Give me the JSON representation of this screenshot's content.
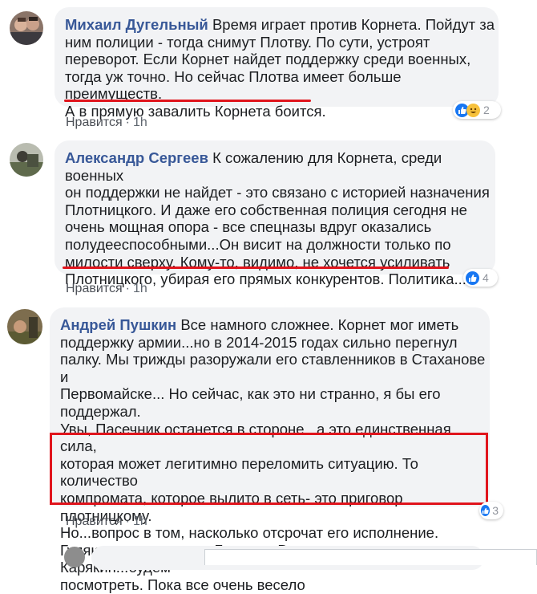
{
  "colors": {
    "highlight": "#e0141c",
    "like": "#1877f2",
    "haha": "#f7c13b"
  },
  "comments": [
    {
      "author": "Михаил Дугельный",
      "lines": [
        "Время играет против Корнета. Пойдут за",
        "ним полиции - тогда снимут Плотву. По сути, устроят",
        "переворот. Если Корнет найдет поддержку среди военных,",
        "тогда уж точно. Но сейчас Плотва имеет больше преимуществ.",
        "А в прямую завалить Корнета боится."
      ],
      "like_label": "Нравится",
      "time": "1h",
      "reaction_count": "2",
      "reactions": [
        "like-icon",
        "haha-icon"
      ]
    },
    {
      "author": "Александр Сергеев",
      "lines": [
        "К сожалению для Корнета, среди военных",
        "он поддержки не найдет - это связано с историей назначения",
        "Плотницкого. И даже его собственная полиция сегодня не",
        "очень мощная опора - все спецназы вдруг оказались",
        "полудееспособными...Он висит на должности только по",
        "милости сверху. Кому-то, видимо, не хочется усиливать",
        "Плотницкого, убирая его прямых конкурентов. Политика..."
      ],
      "like_label": "Нравится",
      "time": "1h",
      "reaction_count": "4",
      "reactions": [
        "like-icon"
      ]
    },
    {
      "author": "Андрей Пушкин",
      "lines": [
        "Все намного сложнее. Корнет мог иметь",
        "поддержку армии...но в 2014-2015 годах сильно перегнул",
        "палку. Мы трижды разоружали его ставленников в Стаханове и",
        "Первомайске... Но сейчас, как это ни странно, я бы его",
        "поддержал.",
        "Увы, Пасечник останется в стороне...а это единственная сила,",
        "которая может легитимно переломить ситуацию. То количество",
        "компромата, которое вылито в сеть- это приговор плотницкому.",
        "Но...вопрос в том, насколько отсрочат его исполнение.",
        "Гуляют разные слухи: Горохов, Волга...и даже Карякин...будем",
        "посмотреть. Пока все очень весело"
      ],
      "like_label": "Нравится",
      "time": "1h",
      "reaction_count": "3",
      "reactions": [
        "like-icon"
      ]
    }
  ],
  "separator": "·"
}
